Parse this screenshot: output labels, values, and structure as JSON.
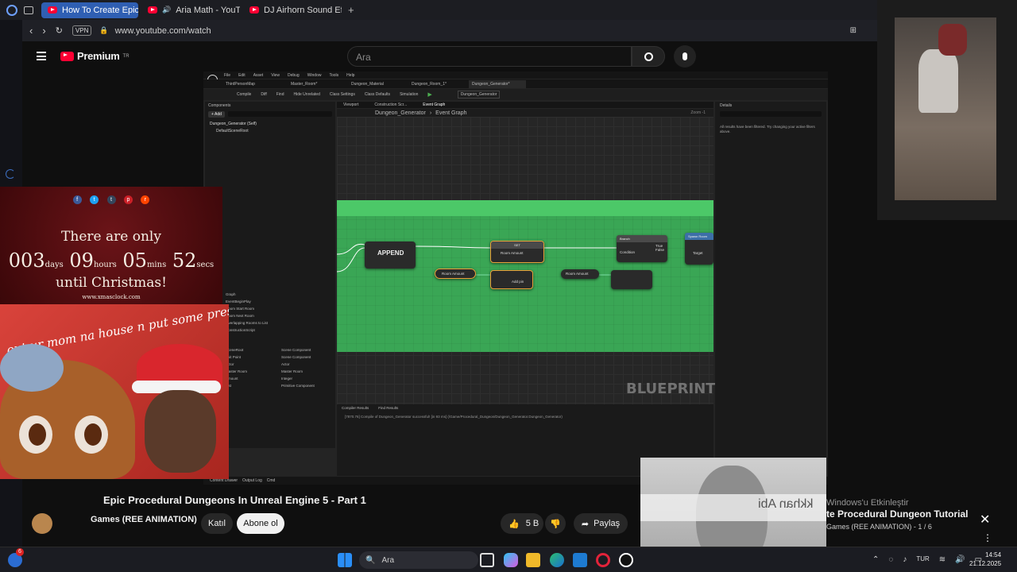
{
  "browser": {
    "tabs": [
      {
        "label": "How To Create Epic P",
        "active": true
      },
      {
        "label": "Aria Math - YouTube",
        "active": false
      },
      {
        "label": "DJ Airhorn Sound Effect (",
        "active": false
      }
    ],
    "vpn_badge": "VPN",
    "url": "www.youtube.com/watch"
  },
  "youtube": {
    "logo_text": "Premium",
    "logo_region": "TR",
    "search_placeholder": "Ara"
  },
  "ue_editor": {
    "menu": [
      "File",
      "Edit",
      "Asset",
      "View",
      "Debug",
      "Window",
      "Tools",
      "Help"
    ],
    "asset_tabs": [
      "ThirdPersonMap",
      "Master_Room*",
      "Dungeon_Material",
      "Dungeon_Room_1*",
      "Dungeon_Generator*"
    ],
    "toolbar": [
      "Compile",
      "Diff",
      "Find",
      "Hide Unrelated",
      "Class Settings",
      "Class Defaults",
      "Simulation"
    ],
    "debug_object": "Dungeon_Generator",
    "components_title": "Components",
    "add_label": "+ Add",
    "component_self": "Dungeon_Generator (Self)",
    "component_root": "DefaultSceneRoot",
    "graph_tabs": [
      "Viewport",
      "Construction Scr...",
      "Event Graph"
    ],
    "breadcrumb_root": "Dungeon_Generator",
    "breadcrumb_leaf": "Event Graph",
    "zoom": "Zoom -1",
    "details_title": "Details",
    "details_msg": "All results have been filtered. Try changing your active filters above.",
    "nodes": {
      "append": "APPEND",
      "set": "SET",
      "room_amount": "Room Amount",
      "room_amount_b": "Room Amount",
      "room_amount_c": "Room Amount",
      "add_pin": "Add pin",
      "branch": "Branch",
      "true": "True",
      "false": "False",
      "condition": "Condition",
      "spawn": "Spawn Room",
      "target": "Target"
    },
    "watermark": "BLUEPRINT",
    "compiler_tab": "Compiler Results",
    "find_tab": "Find Results",
    "log_line": "[7870.76] Compile of Dungeon_Generator successful! [in 93 ms] (/Game/Procedural_Dungeon/Dungeon_Generator.Dungeon_Generator)",
    "bottom_bar": [
      "Content Drawer",
      "Output Log",
      "Cmd"
    ],
    "mybp_items": [
      "Graph",
      "EventBeginPlay",
      "Room Start Room",
      "Room Next Room",
      "Overlapping Rooms to List",
      "ConstructionScript"
    ],
    "var_items": [
      "SceneRoot",
      "Exit Point",
      "Actor",
      "Master Room",
      "Amount",
      "List"
    ],
    "var_types": [
      "Scene Component",
      "Scene Component",
      "Actor",
      "Master Room",
      "Integer",
      "Primitive Component"
    ]
  },
  "xmas": {
    "line1": "There are only",
    "days": "003",
    "days_label": "days",
    "hours": "09",
    "hours_label": "hours",
    "mins": "05",
    "mins_label": "mins",
    "secs": "52",
    "secs_label": "secs",
    "line3": "until Christmas!",
    "site": "www.xmasclock.com"
  },
  "meme": {
    "caption": "out ur mom na house n put some presents in it"
  },
  "video": {
    "title": "Epic Procedural Dungeons In Unreal Engine 5 - Part 1",
    "channel": "Games (REE ANIMATION)",
    "join": "Katıl",
    "subscribe": "Abone ol",
    "likes": "5 B",
    "share": "Paylaş"
  },
  "overlays": {
    "mirror_text": "kkhan Abi",
    "windows_activate": "Windows'u Etkinleştir",
    "playlist_title": "te Procedural Dungeon Tutorial",
    "playlist_meta": "Games (REE ANIMATION) - 1 / 6"
  },
  "taskbar": {
    "search": "Ara",
    "lang": "TUR",
    "time": "14:54",
    "date": "21.12.2025",
    "badge": "6"
  }
}
